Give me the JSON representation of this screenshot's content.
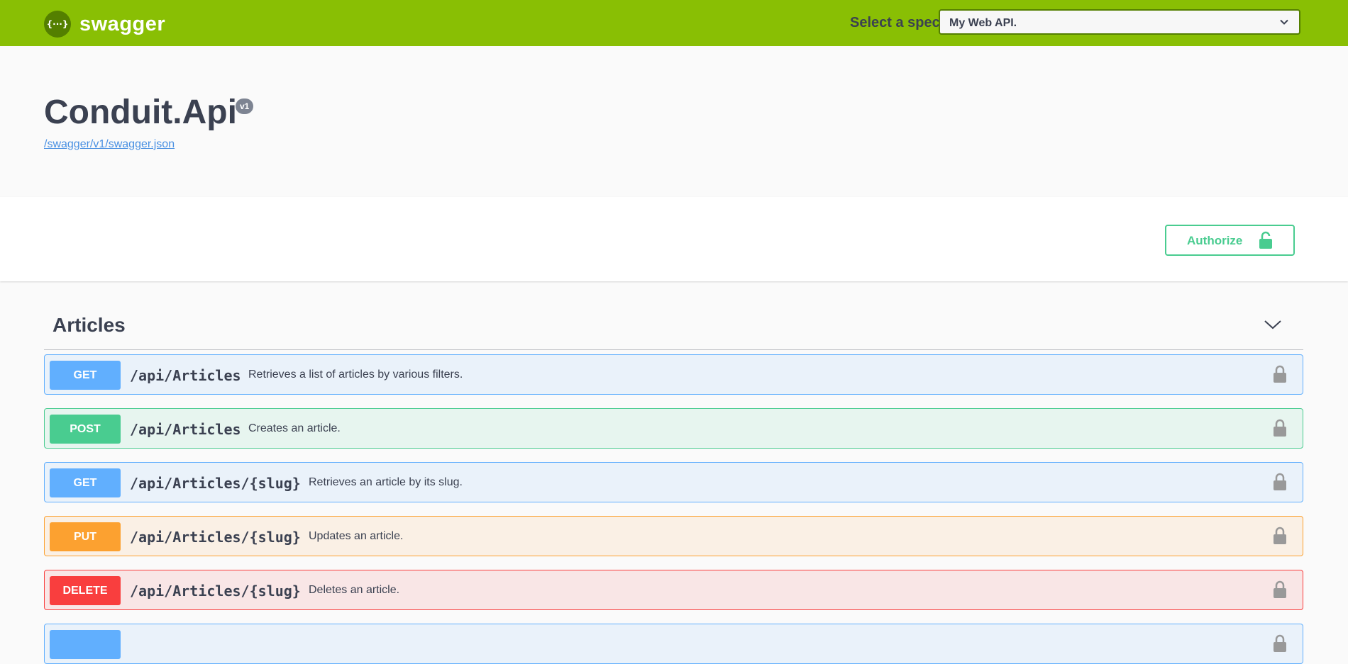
{
  "topbar": {
    "logo_symbol": "{···}",
    "logo_text": "swagger",
    "spec_label": "Select a spec",
    "spec_selected": "My Web API."
  },
  "info": {
    "title": "Conduit.Api",
    "version": "v1",
    "spec_url": "/swagger/v1/swagger.json"
  },
  "scheme": {
    "authorize_label": "Authorize"
  },
  "tag": {
    "name": "Articles"
  },
  "operations": [
    {
      "method": "GET",
      "path": "/api/Articles",
      "summary": "Retrieves a list of articles by various filters."
    },
    {
      "method": "POST",
      "path": "/api/Articles",
      "summary": "Creates an article."
    },
    {
      "method": "GET",
      "path": "/api/Articles/{slug}",
      "summary": "Retrieves an article by its slug."
    },
    {
      "method": "PUT",
      "path": "/api/Articles/{slug}",
      "summary": "Updates an article."
    },
    {
      "method": "DELETE",
      "path": "/api/Articles/{slug}",
      "summary": "Deletes an article."
    },
    {
      "method": "",
      "path": "",
      "summary": ""
    }
  ],
  "colors": {
    "topbar": "#89bf04",
    "get": "#61affe",
    "post": "#49cc90",
    "put": "#fca130",
    "delete": "#f93e3e"
  }
}
